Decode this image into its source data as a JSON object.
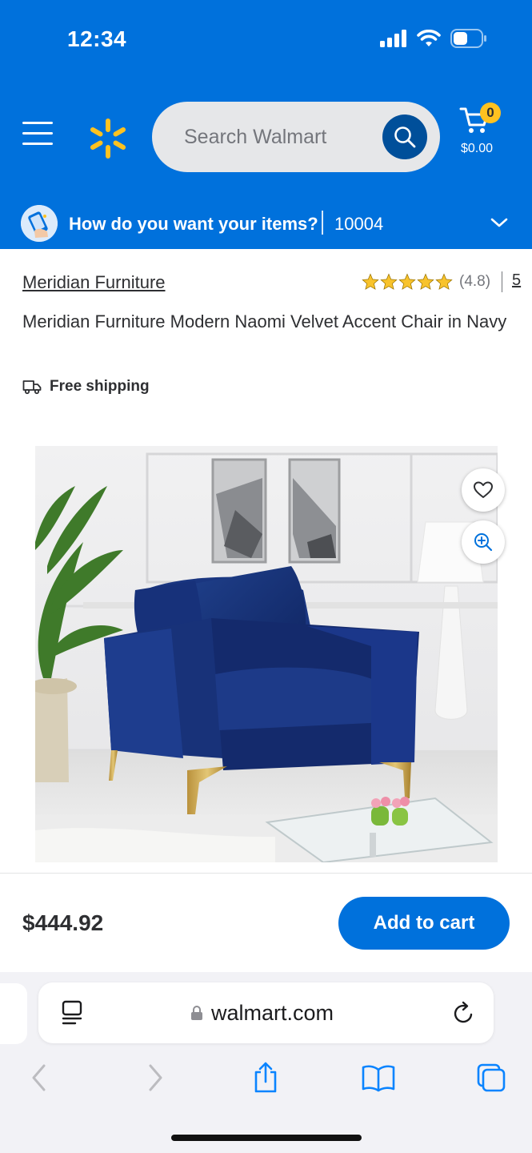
{
  "status_bar": {
    "time": "12:34"
  },
  "header": {
    "search_placeholder": "Search Walmart",
    "cart_count": "0",
    "cart_total": "$0.00",
    "delivery_prompt": "How do you want your items?",
    "zip_code": "10004",
    "brand_color": "#0071dc",
    "accent_color": "#ffc220"
  },
  "product": {
    "brand": "Meridian Furniture",
    "rating": "(4.8)",
    "rating_stars": 4.8,
    "review_count": "5",
    "title": "Meridian Furniture Modern Naomi Velvet Accent Chair in Navy",
    "shipping": "Free shipping",
    "price": "$444.92",
    "add_to_cart": "Add to cart"
  },
  "browser": {
    "url": "walmart.com",
    "icons": [
      "reader-icon",
      "lock-icon",
      "reload-icon",
      "back-icon",
      "forward-icon",
      "share-icon",
      "bookmarks-icon",
      "tabs-icon"
    ]
  }
}
